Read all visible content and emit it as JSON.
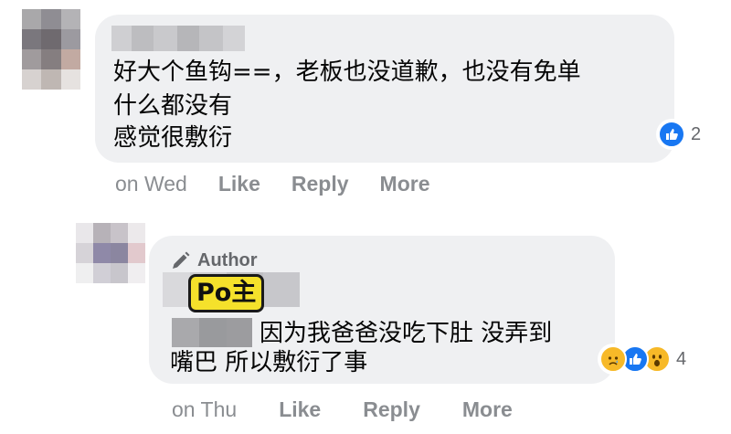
{
  "comment1": {
    "text_lines": [
      "好大个鱼钩==，老板也没道歉，也没有免单",
      "什么都没有",
      "感觉很敷衍"
    ],
    "reaction_count": "2",
    "time": "on Wed",
    "actions": {
      "like": "Like",
      "reply": "Reply",
      "more": "More"
    },
    "reaction_icons": [
      "like-icon"
    ]
  },
  "comment2": {
    "author_badge": "Author",
    "op_tag": "Po主",
    "text_line1": "因为我爸爸没吃下肚 没弄到",
    "text_line2": "嘴巴 所以敷衍了事",
    "reaction_count": "4",
    "time": "on Thu",
    "actions": {
      "like": "Like",
      "reply": "Reply",
      "more": "More"
    },
    "reaction_icons": [
      "sad-icon",
      "like-icon",
      "wow-icon"
    ]
  },
  "colors": {
    "bubble": "#eff0f2",
    "meta_text": "#8a8d91",
    "like_blue": "#1877f2",
    "emoji_yellow": "#f7b928",
    "op_tag_bg": "#f5e12b"
  }
}
